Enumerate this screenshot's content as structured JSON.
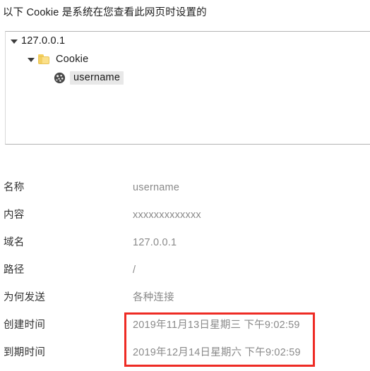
{
  "header": {
    "title": "以下 Cookie 是系统在您查看此网页时设置的"
  },
  "tree": {
    "nodes": [
      {
        "label": "127.0.0.1",
        "icon": "none",
        "expanded": true,
        "selected": false,
        "level": 0
      },
      {
        "label": "Cookie",
        "icon": "folder-icon",
        "expanded": true,
        "selected": false,
        "level": 1
      },
      {
        "label": "username",
        "icon": "cookie-icon",
        "expanded": false,
        "selected": true,
        "level": 2
      }
    ]
  },
  "details": {
    "rows": [
      {
        "label": "名称",
        "value": "username"
      },
      {
        "label": "内容",
        "value": "xxxxxxxxxxxxx"
      },
      {
        "label": "域名",
        "value": "127.0.0.1"
      },
      {
        "label": "路径",
        "value": "/"
      },
      {
        "label": "为何发送",
        "value": "各种连接"
      },
      {
        "label": "创建时间",
        "value": "2019年11月13日星期三 下午9:02:59"
      },
      {
        "label": "到期时间",
        "value": "2019年12月14日星期六 下午9:02:59"
      }
    ]
  },
  "annotation": {
    "color": "#ee2b24",
    "highlights": [
      "创建时间",
      "到期时间"
    ]
  },
  "colors": {
    "label_text": "#303030",
    "value_text": "#8a8a8a",
    "heading_text": "#1d1d1d",
    "selection_bg": "#e8e8e8",
    "panel_border": "#b4b4b4",
    "folder_yellow": "#fbe08a",
    "cookie_gray": "#4a4a4a",
    "annotation_red": "#ee2b24"
  }
}
